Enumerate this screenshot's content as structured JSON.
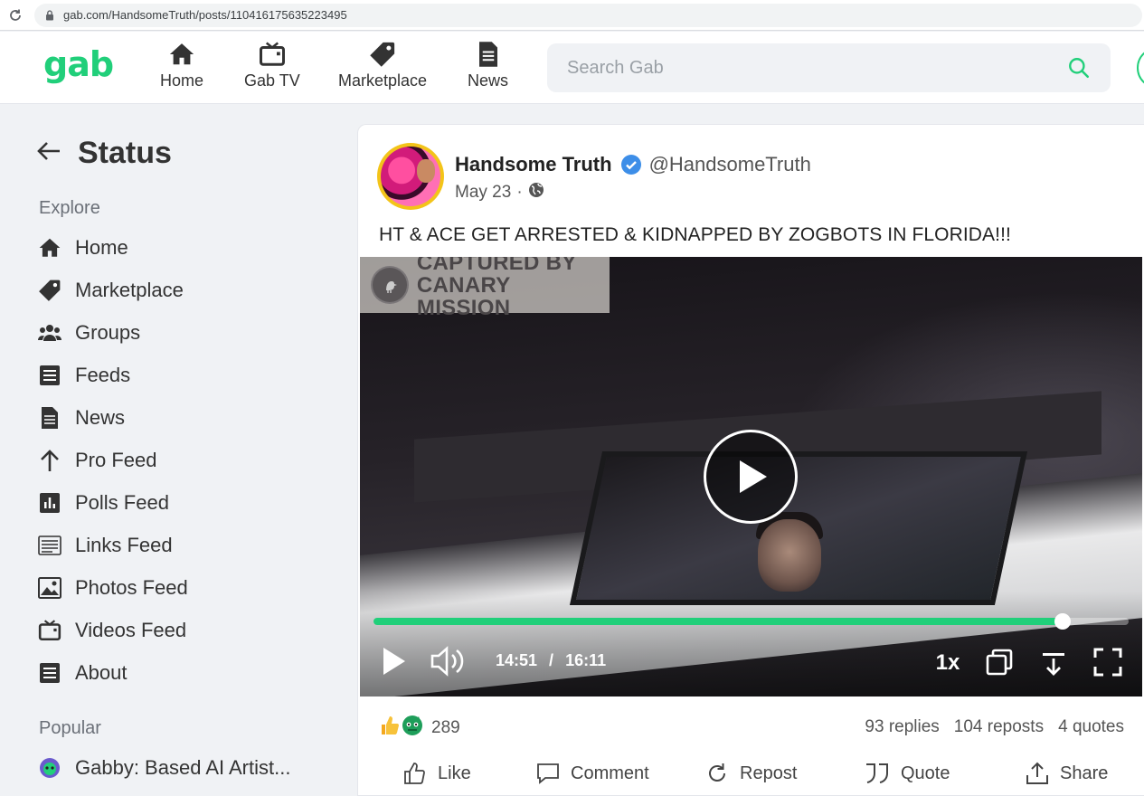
{
  "browser": {
    "url": "gab.com/HandsomeTruth/posts/110416175635223495"
  },
  "header": {
    "logo": "gab",
    "nav": [
      {
        "label": "Home",
        "icon": "home-icon"
      },
      {
        "label": "Gab TV",
        "icon": "tv-icon"
      },
      {
        "label": "Marketplace",
        "icon": "tag-icon"
      },
      {
        "label": "News",
        "icon": "news-icon"
      }
    ],
    "search_placeholder": "Search Gab"
  },
  "sidebar": {
    "title": "Status",
    "explore_label": "Explore",
    "items": [
      {
        "label": "Home",
        "icon": "home-icon"
      },
      {
        "label": "Marketplace",
        "icon": "tag-icon"
      },
      {
        "label": "Groups",
        "icon": "groups-icon"
      },
      {
        "label": "Feeds",
        "icon": "feeds-icon"
      },
      {
        "label": "News",
        "icon": "news-icon"
      },
      {
        "label": "Pro Feed",
        "icon": "arrow-up-icon"
      },
      {
        "label": "Polls Feed",
        "icon": "poll-icon"
      },
      {
        "label": "Links Feed",
        "icon": "links-icon"
      },
      {
        "label": "Photos Feed",
        "icon": "photo-icon"
      },
      {
        "label": "Videos Feed",
        "icon": "tv-icon"
      },
      {
        "label": "About",
        "icon": "about-icon"
      }
    ],
    "popular_label": "Popular",
    "popular": [
      {
        "label": "Gabby: Based AI Artist..."
      }
    ]
  },
  "post": {
    "author_name": "Handsome Truth",
    "handle": "@HandsomeTruth",
    "date": "May 23",
    "separator": "·",
    "text": "HT & ACE GET ARRESTED & KIDNAPPED BY ZOGBOTS IN FLORIDA!!!",
    "video": {
      "watermark_line1": "CAPTURED BY",
      "watermark_line2": "CANARY MISSION",
      "current_time": "14:51",
      "time_separator": "/",
      "duration": "16:11",
      "progress": 0.912,
      "speed": "1x"
    },
    "reaction_count": "289",
    "replies": "93 replies",
    "reposts": "104 reposts",
    "quotes": "4 quotes",
    "actions": {
      "like": "Like",
      "comment": "Comment",
      "repost": "Repost",
      "quote": "Quote",
      "share": "Share"
    }
  },
  "colors": {
    "brand": "#21cf7a",
    "verified": "#3d8ee8"
  }
}
